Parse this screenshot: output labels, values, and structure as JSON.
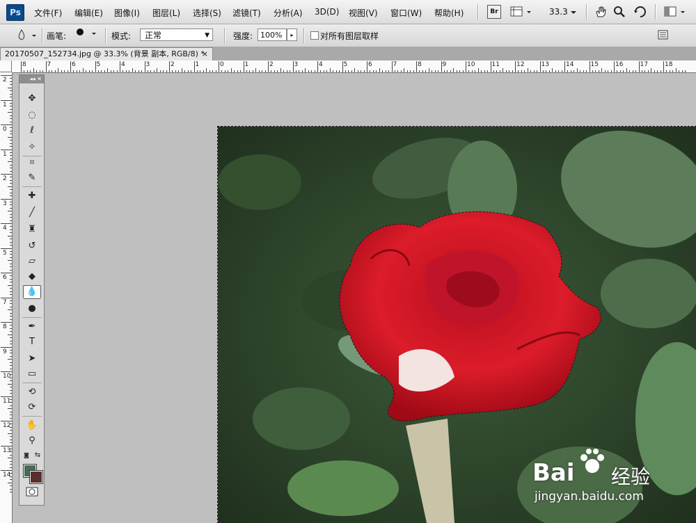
{
  "app": {
    "logo": "Ps",
    "menus": [
      "文件(F)",
      "编辑(E)",
      "图像(I)",
      "图层(L)",
      "选择(S)",
      "滤镜(T)",
      "分析(A)",
      "3D(D)",
      "视图(V)",
      "窗口(W)",
      "帮助(H)"
    ],
    "bridge_label": "Br",
    "zoom": "33.3"
  },
  "options": {
    "brush_label": "画笔:",
    "brush_size": "442",
    "mode_label": "模式:",
    "mode_value": "正常",
    "strength_label": "强度:",
    "strength_value": "100%",
    "sample_all_label": "对所有图层取样"
  },
  "document": {
    "tab_title": "20170507_152734.jpg @ 33.3% (背景 副本, RGB/8) *",
    "close": "×"
  },
  "rulers": {
    "h_labels": [
      "8",
      "7",
      "6",
      "5",
      "4",
      "3",
      "2",
      "1",
      "0",
      "1",
      "2",
      "3",
      "4",
      "5",
      "6",
      "7",
      "8",
      "9",
      "10",
      "11",
      "12",
      "13",
      "14",
      "15",
      "16",
      "17",
      "18"
    ],
    "v_labels": [
      "2",
      "1",
      "0",
      "1",
      "2",
      "3",
      "4",
      "5",
      "6",
      "7",
      "8",
      "9",
      "10",
      "11",
      "12",
      "13",
      "14"
    ]
  },
  "toolbox": {
    "header": "◂◂ ✕",
    "tools": [
      {
        "name": "move-tool",
        "glyph": "✥"
      },
      {
        "name": "marquee-tool",
        "glyph": "◌"
      },
      {
        "name": "lasso-tool",
        "glyph": "ℓ"
      },
      {
        "name": "magic-wand-tool",
        "glyph": "✧"
      },
      {
        "name": "crop-tool",
        "glyph": "⌗"
      },
      {
        "name": "eyedropper-tool",
        "glyph": "✎"
      },
      {
        "name": "healing-brush-tool",
        "glyph": "✚"
      },
      {
        "name": "brush-tool",
        "glyph": "╱"
      },
      {
        "name": "clone-stamp-tool",
        "glyph": "♜"
      },
      {
        "name": "history-brush-tool",
        "glyph": "↺"
      },
      {
        "name": "eraser-tool",
        "glyph": "▱"
      },
      {
        "name": "paint-bucket-tool",
        "glyph": "◆"
      },
      {
        "name": "blur-tool",
        "glyph": "💧"
      },
      {
        "name": "dodge-tool",
        "glyph": "●"
      },
      {
        "name": "pen-tool",
        "glyph": "✒"
      },
      {
        "name": "type-tool",
        "glyph": "T"
      },
      {
        "name": "path-selection-tool",
        "glyph": "➤"
      },
      {
        "name": "shape-tool",
        "glyph": "▭"
      },
      {
        "name": "3d-rotate-tool",
        "glyph": "⟲"
      },
      {
        "name": "3d-orbit-tool",
        "glyph": "⟳"
      },
      {
        "name": "hand-tool",
        "glyph": "✋"
      },
      {
        "name": "zoom-tool",
        "glyph": "⚲"
      }
    ],
    "swap_glyph": "⇆",
    "quickmask_glyph": "◙",
    "foreground_color": "#466b56",
    "background_color": "#5a2e2e"
  },
  "watermark": {
    "brand": "Bai",
    "brand_suffix": "经验",
    "url": "jingyan.baidu.com"
  }
}
